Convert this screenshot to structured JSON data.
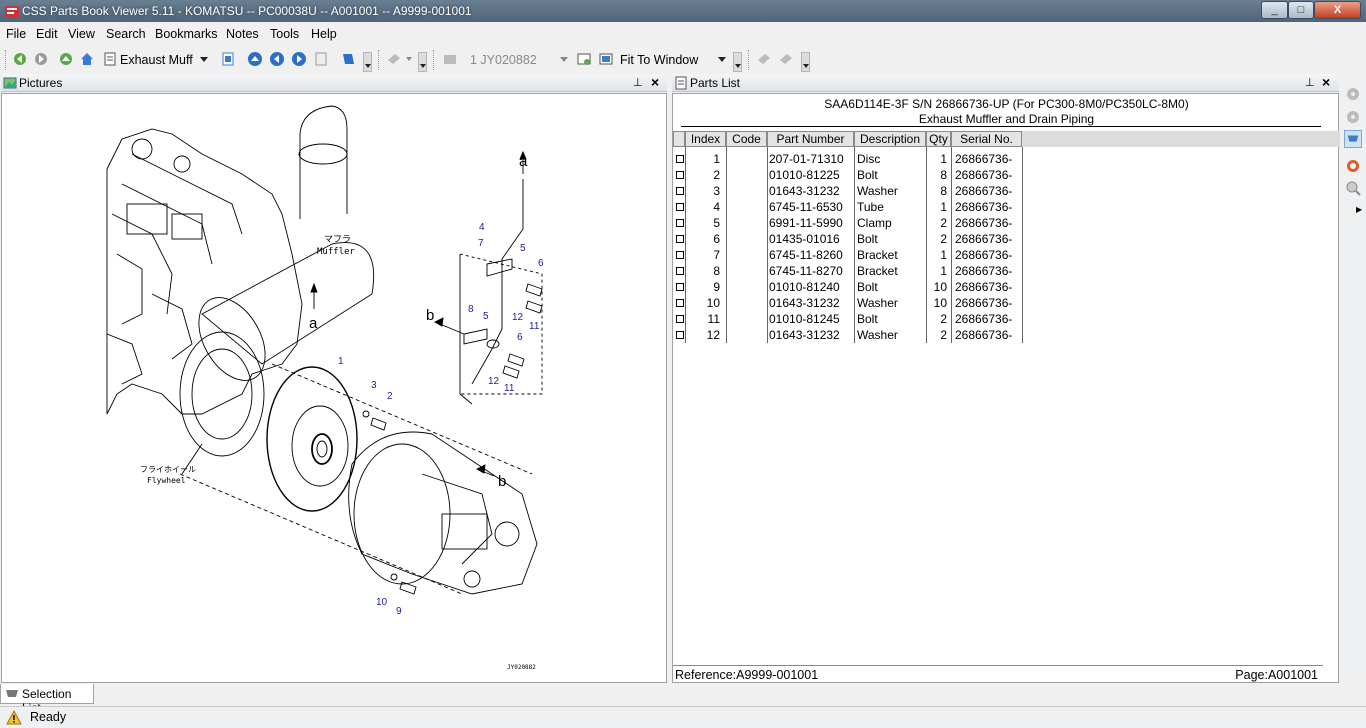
{
  "titlebar": {
    "title": "CSS Parts Book Viewer 5.11 - KOMATSU -- PC00038U -- A001001 -- A9999-001001"
  },
  "window_controls": {
    "minimize": "_",
    "maximize": "□",
    "close": "X"
  },
  "menu": [
    "File",
    "Edit",
    "View",
    "Search",
    "Bookmarks",
    "Notes",
    "Tools",
    "Help"
  ],
  "toolbar": {
    "section_combo": "Exhaust Muff",
    "figure_combo": "1 JY020882",
    "zoom_combo": "Fit To Window"
  },
  "pictures_panel": {
    "title": "Pictures"
  },
  "drawing": {
    "labels": {
      "muffler_jp": "マフラ",
      "muffler_en": "Muffler",
      "flywheel_jp": "フライホイール",
      "flywheel_en": "Flywheel",
      "a": "a",
      "b": "b",
      "drawing_no": "JY020882"
    },
    "callouts": [
      "1",
      "2",
      "3",
      "4",
      "5",
      "6",
      "7",
      "8",
      "9",
      "10",
      "11",
      "12"
    ]
  },
  "parts_panel": {
    "title": "Parts List",
    "header_line1": "SAA6D114E-3F S/N 26866736-UP (For PC300-8M0/PC350LC-8M0)",
    "header_line2": "Exhaust Muffler and Drain Piping",
    "columns": [
      "Index",
      "Code",
      "Part Number",
      "Description",
      "Qty",
      "Serial No."
    ],
    "rows": [
      {
        "index": "1",
        "code": "",
        "part": "207-01-71310",
        "desc": "Disc",
        "qty": "1",
        "serial": "26866736-"
      },
      {
        "index": "2",
        "code": "",
        "part": "01010-81225",
        "desc": "Bolt",
        "qty": "8",
        "serial": "26866736-"
      },
      {
        "index": "3",
        "code": "",
        "part": "01643-31232",
        "desc": "Washer",
        "qty": "8",
        "serial": "26866736-"
      },
      {
        "index": "4",
        "code": "",
        "part": "6745-11-6530",
        "desc": "Tube",
        "qty": "1",
        "serial": "26866736-"
      },
      {
        "index": "5",
        "code": "",
        "part": "6991-11-5990",
        "desc": "Clamp",
        "qty": "2",
        "serial": "26866736-"
      },
      {
        "index": "6",
        "code": "",
        "part": "01435-01016",
        "desc": "Bolt",
        "qty": "2",
        "serial": "26866736-"
      },
      {
        "index": "7",
        "code": "",
        "part": "6745-11-8260",
        "desc": "Bracket",
        "qty": "1",
        "serial": "26866736-"
      },
      {
        "index": "8",
        "code": "",
        "part": "6745-11-8270",
        "desc": "Bracket",
        "qty": "1",
        "serial": "26866736-"
      },
      {
        "index": "9",
        "code": "",
        "part": "01010-81240",
        "desc": "Bolt",
        "qty": "10",
        "serial": "26866736-"
      },
      {
        "index": "10",
        "code": "",
        "part": "01643-31232",
        "desc": "Washer",
        "qty": "10",
        "serial": "26866736-"
      },
      {
        "index": "11",
        "code": "",
        "part": "01010-81245",
        "desc": "Bolt",
        "qty": "2",
        "serial": "26866736-"
      },
      {
        "index": "12",
        "code": "",
        "part": "01643-31232",
        "desc": "Washer",
        "qty": "2",
        "serial": "26866736-"
      }
    ],
    "reference": "Reference:A9999-001001",
    "page": "Page:A001001"
  },
  "bottom_tab": {
    "label": "Selection List"
  },
  "status": {
    "text": "Ready"
  },
  "colors": {
    "titlebar": "#56697e",
    "callout": "#2020a0",
    "selected_tool": "#cfe3f7"
  },
  "icons": [
    "back-icon",
    "forward-icon",
    "up-icon",
    "home-icon",
    "book-icon",
    "page-icon",
    "nav-up-icon",
    "nav-left-icon",
    "nav-right-icon",
    "print-icon",
    "bookmark-icon",
    "note-icon",
    "camera-icon",
    "zoom-icon",
    "warning-icon"
  ]
}
